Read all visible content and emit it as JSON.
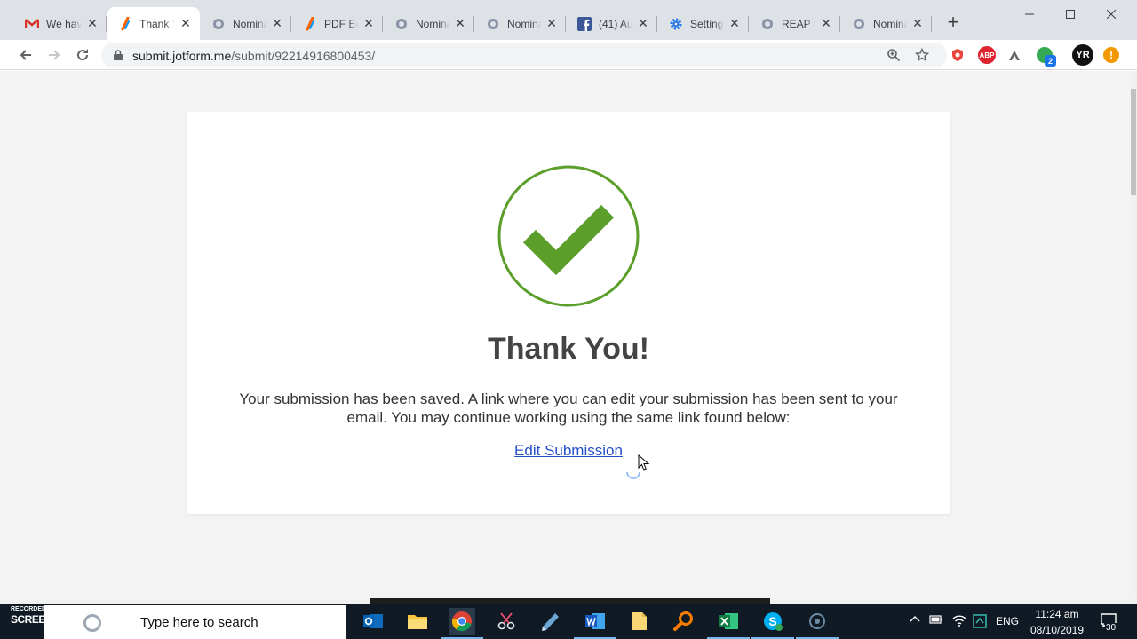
{
  "browser": {
    "tabs": [
      {
        "title": "We have",
        "icon": "gmail-icon",
        "active": false
      },
      {
        "title": "Thank You",
        "icon": "jotform-icon",
        "active": true
      },
      {
        "title": "Nominate",
        "icon": "crest-icon",
        "active": false
      },
      {
        "title": "PDF Editor",
        "icon": "jotform-icon",
        "active": false
      },
      {
        "title": "Nominate",
        "icon": "crest-icon",
        "active": false
      },
      {
        "title": "Nominate",
        "icon": "crest-icon",
        "active": false
      },
      {
        "title": "(41) Au",
        "icon": "facebook-icon",
        "active": false
      },
      {
        "title": "Settings",
        "icon": "gear-icon",
        "active": false
      },
      {
        "title": "REAP U",
        "icon": "crest-icon",
        "active": false
      },
      {
        "title": "Nominate",
        "icon": "crest-icon",
        "active": false
      }
    ],
    "url_host": "submit.jotform.me",
    "url_path": "/submit/92214916800453/",
    "profile_initials": "YR",
    "extension_badge": "2"
  },
  "page": {
    "heading": "Thank You!",
    "message": "Your submission has been saved.  A link where you can edit your submission has been sent to your email.  You may continue working using the same link found below:",
    "edit_link": "Edit Submission",
    "check_color": "#5b9e2a"
  },
  "taskbar": {
    "search_placeholder": "Type here to search",
    "watermark_small": "RECORDED WITH",
    "watermark_big": "SCREENCAST-O-MATIC",
    "language": "ENG",
    "time": "11:24 am",
    "date": "08/10/2019",
    "notification_count": "30"
  }
}
